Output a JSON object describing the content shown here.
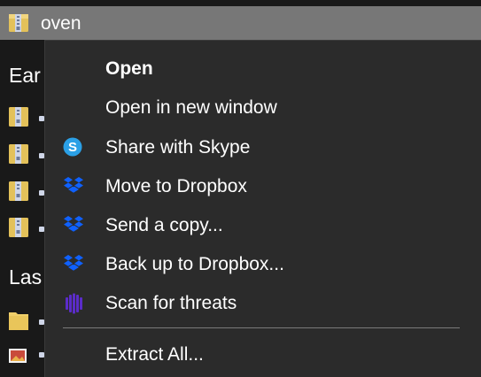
{
  "selected_item": {
    "label": "oven",
    "icon": "zip-folder-icon"
  },
  "left_column": {
    "group_headers": [
      "Ear",
      "Las"
    ]
  },
  "context_menu": {
    "items": [
      {
        "label": "Open",
        "icon": ""
      },
      {
        "label": "Open in new window",
        "icon": ""
      },
      {
        "label": "Share with Skype",
        "icon": "skype-icon"
      },
      {
        "label": "Move to Dropbox",
        "icon": "dropbox-icon"
      },
      {
        "label": "Send a copy...",
        "icon": "dropbox-icon"
      },
      {
        "label": "Back up to Dropbox...",
        "icon": "dropbox-icon"
      },
      {
        "label": "Scan for threats",
        "icon": "sophos-shield-icon"
      },
      {
        "label": "Extract All...",
        "icon": ""
      }
    ]
  },
  "colors": {
    "selected_row": "#777777",
    "menu_bg": "#2b2b2b",
    "skype": "#2ba0e6",
    "dropbox": "#0f61ff",
    "scan": "#5b2cc9"
  }
}
